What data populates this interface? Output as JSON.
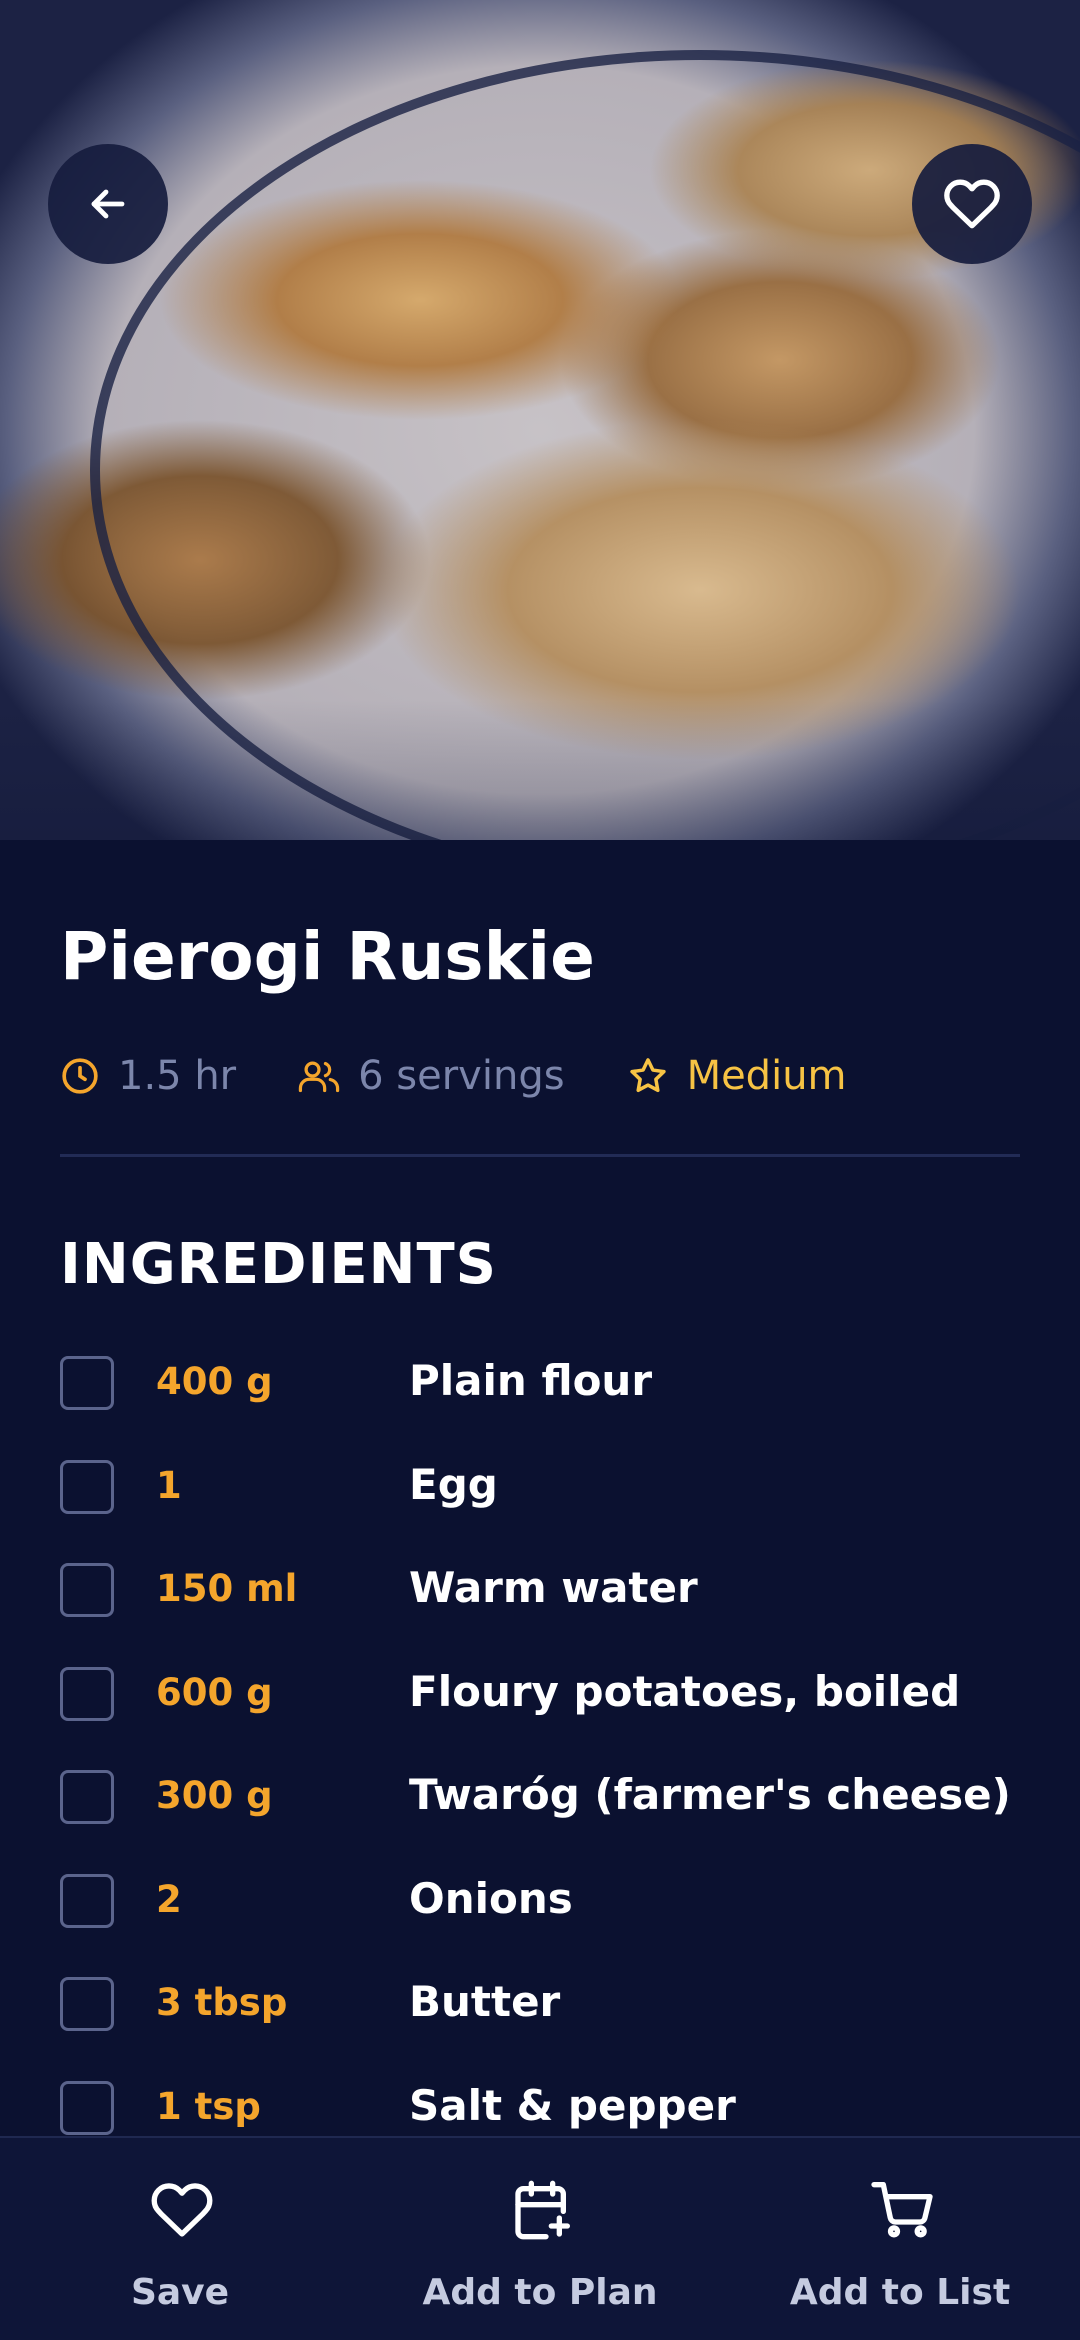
{
  "hero": {
    "image_alt": "Pan-fried pierogi on a plate"
  },
  "header": {
    "back_icon": "arrow-left-icon",
    "favorite_icon": "heart-icon"
  },
  "recipe": {
    "title": "Pierogi Ruskie",
    "time": "1.5 hr",
    "servings": "6 servings",
    "difficulty": "Medium"
  },
  "ingredients": {
    "heading": "INGREDIENTS",
    "items": [
      {
        "qty": "400 g",
        "name": "Plain flour",
        "checked": false
      },
      {
        "qty": "1",
        "name": "Egg",
        "checked": false
      },
      {
        "qty": "150 ml",
        "name": "Warm water",
        "checked": false
      },
      {
        "qty": "600 g",
        "name": "Floury potatoes, boiled",
        "checked": false
      },
      {
        "qty": "300 g",
        "name": "Twaróg (farmer's cheese)",
        "checked": false
      },
      {
        "qty": "2",
        "name": "Onions",
        "checked": false
      },
      {
        "qty": "3 tbsp",
        "name": "Butter",
        "checked": false
      },
      {
        "qty": "1 tsp",
        "name": "Salt & pepper",
        "checked": false
      }
    ]
  },
  "bottom_bar": {
    "save": {
      "label": "Save",
      "icon": "heart-outline-icon"
    },
    "plan": {
      "label": "Add to Plan",
      "icon": "calendar-plus-icon"
    },
    "list": {
      "label": "Add to List",
      "icon": "cart-icon"
    }
  },
  "colors": {
    "background": "#0b1130",
    "accent_yellow": "#f7c344",
    "accent_orange": "#f4a52c",
    "muted_text": "#7c86ab"
  }
}
